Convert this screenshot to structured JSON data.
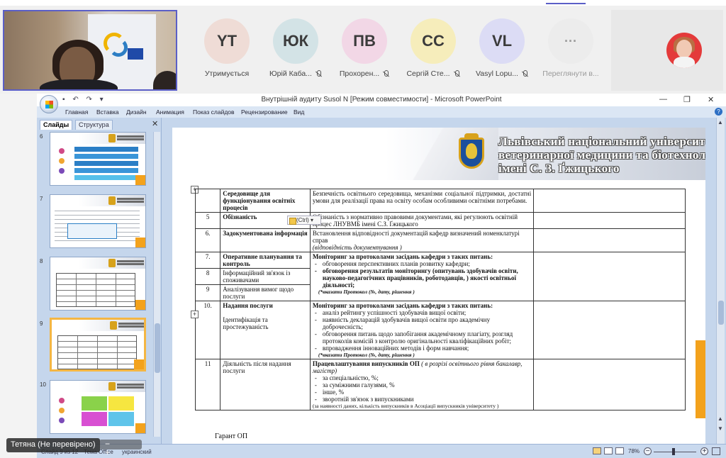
{
  "meeting": {
    "self_video_name": "Тетяна (Не перевірено)",
    "participants": [
      {
        "initials": "YT",
        "name": "Утримується",
        "color": "#efdcd6",
        "muted": false
      },
      {
        "initials": "ЮК",
        "name": "Юрій Каба...",
        "color": "#d3e3e6",
        "muted": true
      },
      {
        "initials": "ПВ",
        "name": "Прохорен...",
        "color": "#f2d7e6",
        "muted": true
      },
      {
        "initials": "СС",
        "name": "Сергій Сте...",
        "color": "#f6edbb",
        "muted": true
      },
      {
        "initials": "VL",
        "name": "Vasyl Lopu...",
        "color": "#dcdcf5",
        "muted": true
      },
      {
        "initials": "···",
        "name": "Переглянути в...",
        "color": "#ececec",
        "muted": false
      }
    ]
  },
  "window": {
    "title": "Внутрішній аудиту Susol N [Режим совместимости] - Microsoft PowerPoint",
    "qat": "▪ ↶ ↷ ▾",
    "minimize": "—",
    "restore": "❐",
    "close": "✕",
    "help": "?"
  },
  "menu": [
    "Главная",
    "Вставка",
    "Дизайн",
    "Анимация",
    "Показ слайдов",
    "Рецензирование",
    "Вид"
  ],
  "panel": {
    "tab_slides": "Слайды",
    "tab_outline": "Структура",
    "close": "✕",
    "thumbs": [
      {
        "num": "6"
      },
      {
        "num": "7"
      },
      {
        "num": "8"
      },
      {
        "num": "9"
      },
      {
        "num": "10"
      }
    ]
  },
  "slide": {
    "university": [
      "Львівський національний університет",
      "ветеринарної медицини та біотехнологій",
      "імені С. З. Ґжицького"
    ],
    "paste_options": "(Ctrl) ▾",
    "footer": "Гарант ОП",
    "rows": {
      "r0": {
        "num": "",
        "name": "Середовище для функціонування освітніх процесів",
        "desc": "Безпечність освітнього середовища, механізми соціальної підтримки, достатні умови для реалізації права на освіту особам особливими освітніми потребами."
      },
      "r5": {
        "num": "5",
        "name": "Обізнаність",
        "desc": "Обізнаність з нормативно правовими документами, які регулюють освітній процес ЛНУВМБ імені С.З. Ґжицького"
      },
      "r6": {
        "num": "6.",
        "name": "Задокументована інформація",
        "desc": "Встановлення відповідності документацій кафедр визначений номенклатурі справ",
        "desc_note": "(відповідність документування )"
      },
      "r7": {
        "num": "7.",
        "name": "Оперативне планування та контроль",
        "head": "Моніторинг за протоколами засідань кафедри з таких питань:",
        "items": [
          "обговорення перспективних планів розвитку кафедри;",
          "обговорення результатів моніторингу (опитувань здобувачів освіти, науково-педагогічних працівників, роботодавців, ) якості освітньої діяльності;"
        ],
        "note": "(*вказати Протокол (№, дату, рішення )"
      },
      "r8": {
        "num": "8",
        "name": "Інформаційний зв'язок із споживачами"
      },
      "r9": {
        "num": "9",
        "name": "Аналізування вимог щодо послуги"
      },
      "r10": {
        "num": "10.",
        "name": "Надання послуги",
        "name2": "Ідентифікація та простежуваність",
        "head": "Моніторинг за протоколами засідань кафедри з таких питань:",
        "items": [
          "аналіз рейтингу успішності здобувачів вищої освіти;",
          "наявність декларацій здобувачів вищої освіти про академічну доброчесність;",
          "обговорення питань щодо запобігання академічному плагіату, розгляд протоколів комісій з контролю оригінальності кваліфікаційних робіт;",
          "впровадження інноваційних методів і форм навчання;"
        ],
        "note": "(*вказати Протокол (№, дату, рішення )"
      },
      "r11": {
        "num": "11",
        "name": "Діяльність після надання послуги",
        "head": "Працевлаштування випускників ОП",
        "head_note": "( в розрізі освітнього рівня бакалавр, магістр)",
        "items": [
          "за спеціальністю, %;",
          "за суміжними галузями, %",
          "інше, %",
          "зворотній зв'язок з випускниками"
        ],
        "note": "(за наявності даних, кількість випускників в Асоціації випускників університету )"
      }
    }
  },
  "status": {
    "slide_of": "Слайд 9 из 12",
    "theme": "Тема Office",
    "language": "украинский",
    "zoom": "78%",
    "zoom_minus": "−",
    "zoom_plus": "+"
  }
}
